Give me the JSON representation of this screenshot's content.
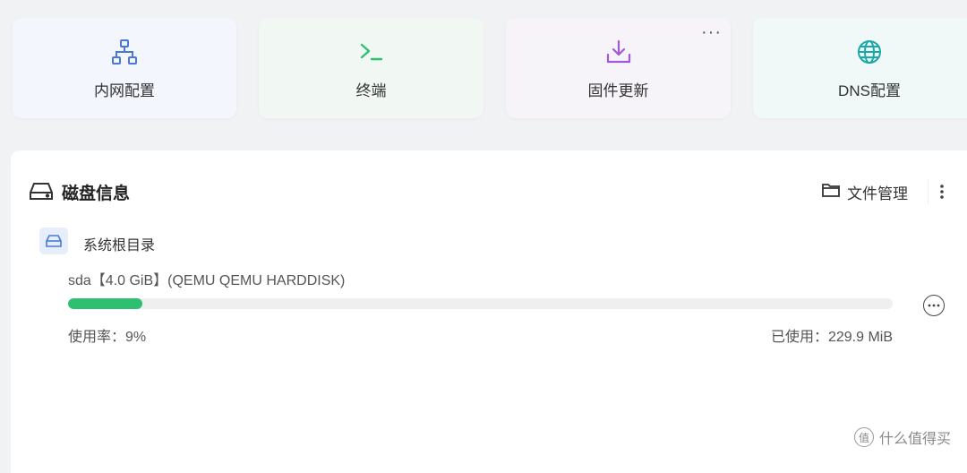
{
  "tiles": [
    {
      "label": "内网配置",
      "icon": "network-icon"
    },
    {
      "label": "终端",
      "icon": "terminal-icon"
    },
    {
      "label": "固件更新",
      "icon": "download-icon"
    },
    {
      "label": "DNS配置",
      "icon": "globe-icon"
    }
  ],
  "tile_more": "···",
  "colors": {
    "blue": "#4a78d6",
    "green": "#2fbf71",
    "purple": "#a259d9",
    "teal": "#1aa8a8"
  },
  "disk_card": {
    "title": "磁盘信息",
    "file_button_label": "文件管理",
    "mount": {
      "name": "系统根目录",
      "disk_label": "sda【4.0 GiB】(QEMU QEMU HARDDISK)",
      "usage_text": "使用率：9%",
      "used_text": "已使用：229.9 MiB",
      "usage_percent": 9
    }
  },
  "watermark": {
    "logo": "值",
    "text": "什么值得买"
  }
}
